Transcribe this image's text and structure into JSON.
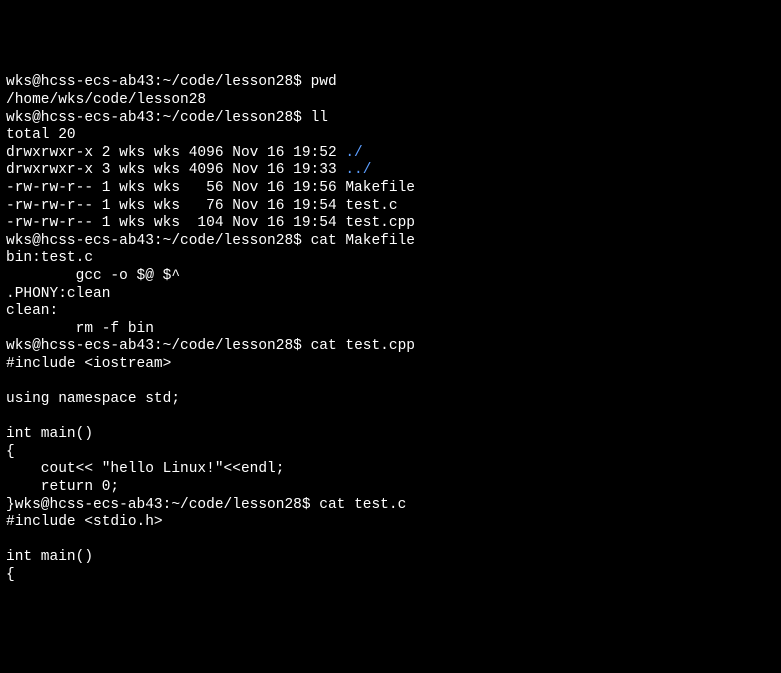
{
  "lines": [
    {
      "type": "prompt",
      "prompt": "wks@hcss-ecs-ab43:~/code/lesson28$ ",
      "cmd": "pwd"
    },
    {
      "type": "output",
      "text": "/home/wks/code/lesson28"
    },
    {
      "type": "prompt",
      "prompt": "wks@hcss-ecs-ab43:~/code/lesson28$ ",
      "cmd": "ll"
    },
    {
      "type": "output",
      "text": "total 20"
    },
    {
      "type": "ls-dir",
      "perms": "drwxrwxr-x 2 wks wks 4096 Nov 16 19:52 ",
      "name": "./"
    },
    {
      "type": "ls-dir",
      "perms": "drwxrwxr-x 3 wks wks 4096 Nov 16 19:33 ",
      "name": "../"
    },
    {
      "type": "output",
      "text": "-rw-rw-r-- 1 wks wks   56 Nov 16 19:56 Makefile"
    },
    {
      "type": "output",
      "text": "-rw-rw-r-- 1 wks wks   76 Nov 16 19:54 test.c"
    },
    {
      "type": "output",
      "text": "-rw-rw-r-- 1 wks wks  104 Nov 16 19:54 test.cpp"
    },
    {
      "type": "prompt",
      "prompt": "wks@hcss-ecs-ab43:~/code/lesson28$ ",
      "cmd": "cat Makefile"
    },
    {
      "type": "output",
      "text": "bin:test.c"
    },
    {
      "type": "output",
      "text": "        gcc -o $@ $^"
    },
    {
      "type": "output",
      "text": ".PHONY:clean"
    },
    {
      "type": "output",
      "text": "clean:"
    },
    {
      "type": "output",
      "text": "        rm -f bin"
    },
    {
      "type": "prompt",
      "prompt": "wks@hcss-ecs-ab43:~/code/lesson28$ ",
      "cmd": "cat test.cpp"
    },
    {
      "type": "output",
      "text": "#include <iostream>"
    },
    {
      "type": "output",
      "text": ""
    },
    {
      "type": "output",
      "text": "using namespace std;"
    },
    {
      "type": "output",
      "text": ""
    },
    {
      "type": "output",
      "text": "int main()"
    },
    {
      "type": "output",
      "text": "{"
    },
    {
      "type": "output",
      "text": "    cout<< \"hello Linux!\"<<endl;"
    },
    {
      "type": "output",
      "text": "    return 0;"
    },
    {
      "type": "prompt-inline",
      "pre": "}",
      "prompt": "wks@hcss-ecs-ab43:~/code/lesson28$ ",
      "cmd": "cat test.c"
    },
    {
      "type": "output",
      "text": "#include <stdio.h>"
    },
    {
      "type": "output",
      "text": ""
    },
    {
      "type": "output",
      "text": "int main()"
    },
    {
      "type": "output",
      "text": "{"
    }
  ]
}
